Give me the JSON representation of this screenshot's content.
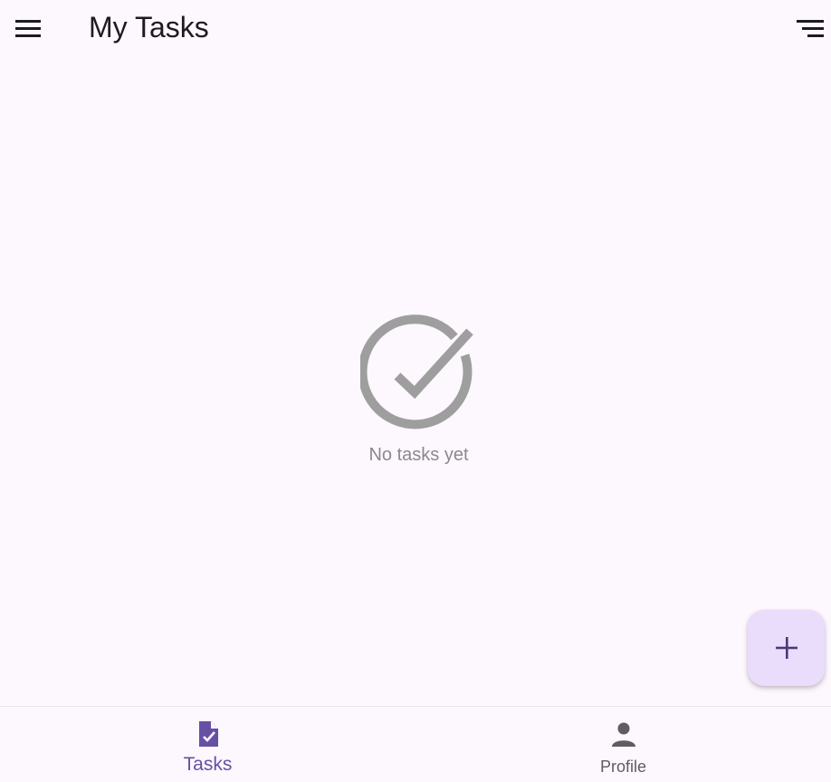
{
  "app_bar": {
    "title": "My Tasks",
    "menu_icon": "menu-icon",
    "filter_icon": "filter-icon"
  },
  "empty_state": {
    "icon": "check-circle-icon",
    "message": "No tasks yet"
  },
  "fab": {
    "icon": "add-icon"
  },
  "bottom_nav": {
    "items": [
      {
        "label": "Tasks",
        "icon": "task-icon",
        "selected": true
      },
      {
        "label": "Profile",
        "icon": "person-icon",
        "selected": false
      }
    ]
  },
  "colors": {
    "background": "#fdf7fe",
    "primary": "#6750a4",
    "fab_container": "#eaddfb",
    "on_surface": "#1d1b20",
    "empty_gray": "#9e9e9e",
    "inactive_nav": "#5f5c62"
  }
}
